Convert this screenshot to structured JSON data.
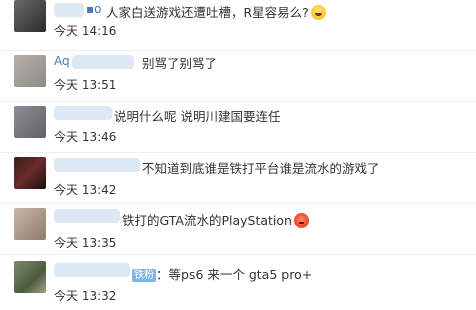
{
  "comments": [
    {
      "name": "▪o",
      "text": "人家白送游戏还遭吐槽，R星容易么?",
      "emoji": "laughing-face",
      "time": "今天 14:16"
    },
    {
      "name": "Aq",
      "text": "别骂了别骂了",
      "time": "今天 13:51"
    },
    {
      "name": "",
      "text": "说明什么呢 说明川建国要连任",
      "time": "今天 13:46"
    },
    {
      "name": "",
      "text": "不知道到底谁是铁打平台谁是流水的游戏了",
      "time": "今天 13:42"
    },
    {
      "name": "",
      "text": "铁打的GTA流水的PlayStation",
      "emoji": "angry-face",
      "time": "今天 13:35"
    },
    {
      "name": "",
      "badge": "铁粉",
      "text": "：等ps6 来一个 gta5 pro+",
      "time": "今天 13:32"
    }
  ]
}
